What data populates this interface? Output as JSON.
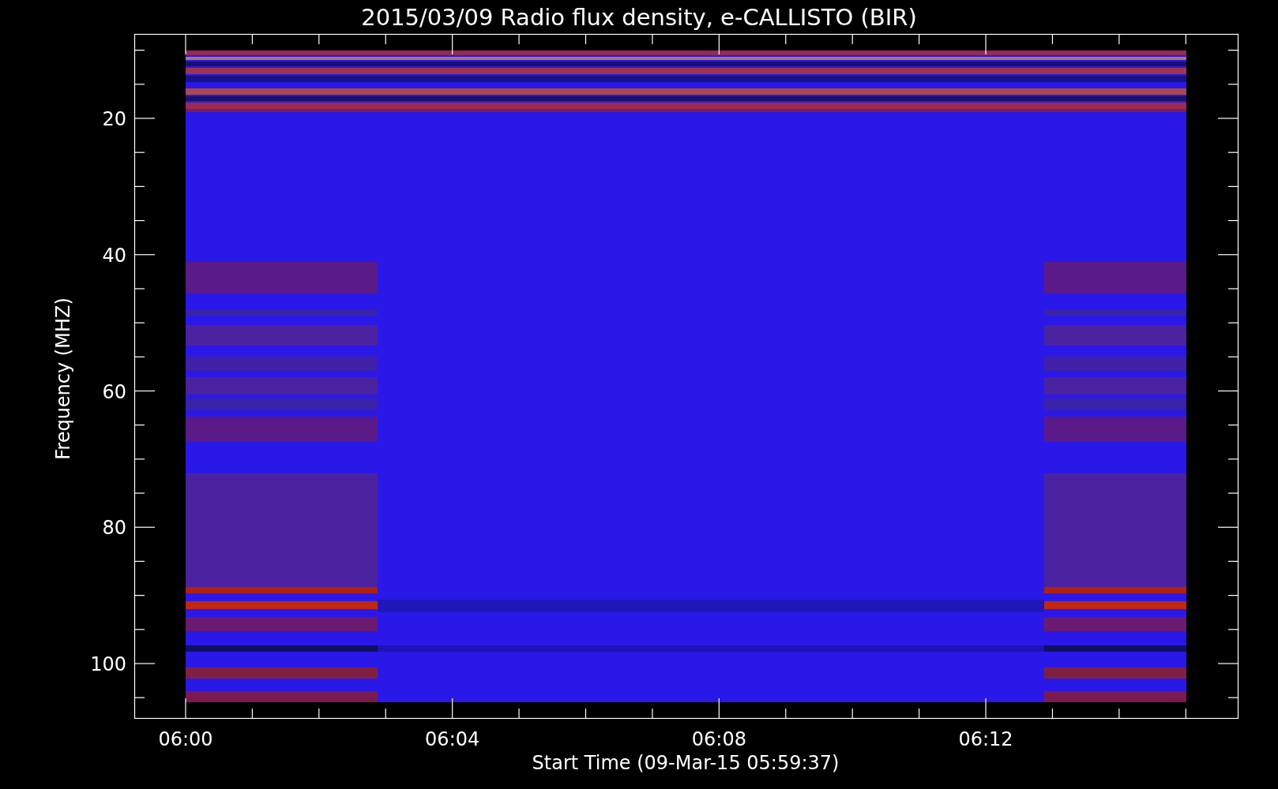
{
  "title": "2015/03/09  Radio flux density, e-CALLISTO (BIR)",
  "y_axis": {
    "label": "Frequency (MHZ)",
    "ticks": [
      "20",
      "40",
      "60",
      "80",
      "100"
    ]
  },
  "x_axis": {
    "label": "Start Time (09-Mar-15 05:59:37)",
    "ticks": [
      "06:00",
      "06:04",
      "06:08",
      "06:12"
    ]
  }
}
